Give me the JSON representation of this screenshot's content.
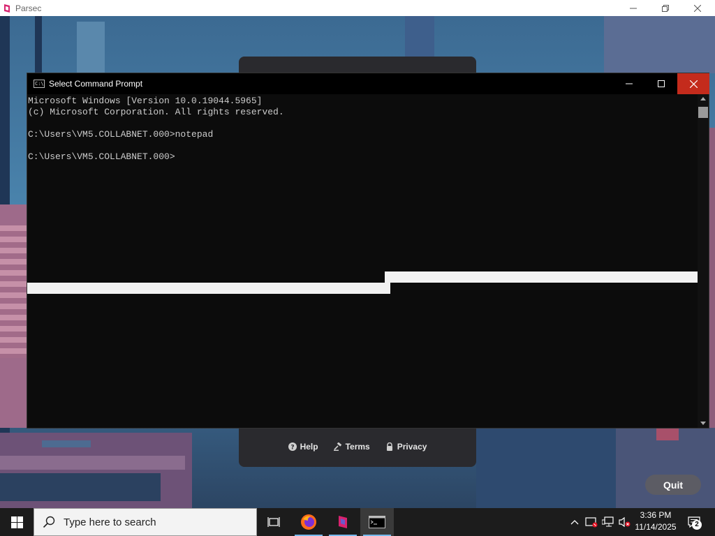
{
  "parsec": {
    "window_title": "Parsec",
    "links": [
      {
        "label": "Help",
        "icon": "help-icon"
      },
      {
        "label": "Terms",
        "icon": "gavel-icon"
      },
      {
        "label": "Privacy",
        "icon": "lock-icon"
      }
    ],
    "quit_label": "Quit"
  },
  "cmd": {
    "title": "Select Command Prompt",
    "lines": [
      "Microsoft Windows [Version 10.0.19044.5965]",
      "(c) Microsoft Corporation. All rights reserved.",
      "",
      "C:\\Users\\VM5.COLLABNET.000>notepad",
      "",
      "C:\\Users\\VM5.COLLABNET.000>"
    ],
    "close_color": "#c42b1c"
  },
  "taskbar": {
    "search_placeholder": "Type here to search",
    "time": "3:36 PM",
    "date": "11/14/2025",
    "notification_count": "2",
    "accent": "#76b9ed"
  }
}
